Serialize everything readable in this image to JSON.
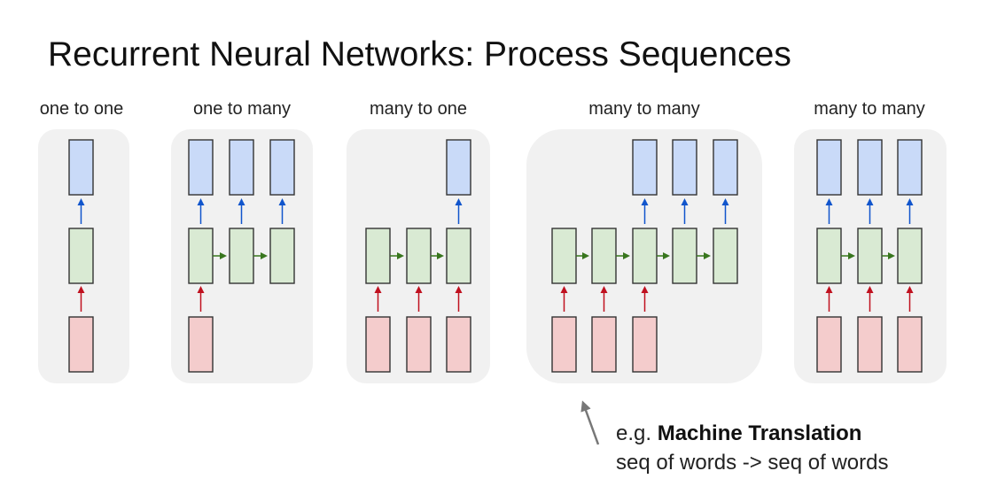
{
  "title": "Recurrent Neural Networks: Process Sequences",
  "panels": [
    {
      "label": "one to one"
    },
    {
      "label": "one to many"
    },
    {
      "label": "many to one"
    },
    {
      "label": "many to many"
    },
    {
      "label": "many to many"
    }
  ],
  "caption": {
    "prefix": "e.g. ",
    "bold": "Machine Translation",
    "line2": "seq of words -> seq of words"
  },
  "colors": {
    "panel_bg": "#f1f1f1",
    "input_fill": "#f4cccc",
    "hidden_fill": "#d9ead3",
    "output_fill": "#c9daf8",
    "input_arrow": "#c0111f",
    "hidden_arrow": "#38761d",
    "output_arrow": "#1155cc",
    "pointer_arrow": "#777777"
  }
}
